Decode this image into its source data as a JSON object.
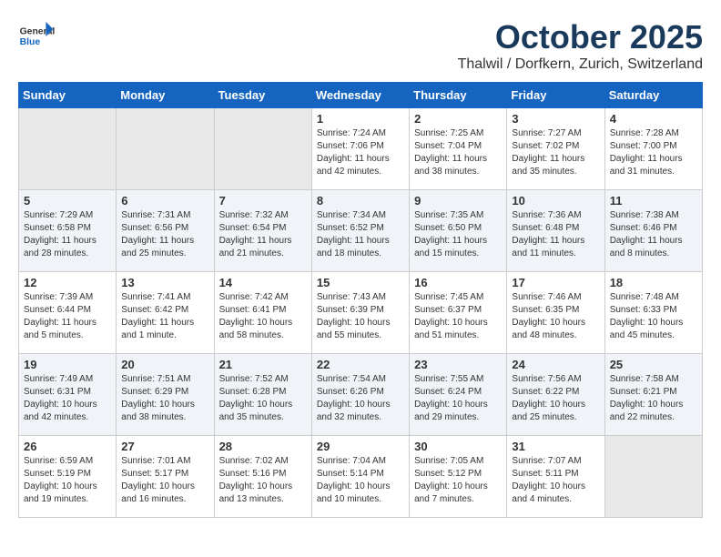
{
  "header": {
    "logo_general": "General",
    "logo_blue": "Blue",
    "month": "October 2025",
    "location": "Thalwil / Dorfkern, Zurich, Switzerland"
  },
  "weekdays": [
    "Sunday",
    "Monday",
    "Tuesday",
    "Wednesday",
    "Thursday",
    "Friday",
    "Saturday"
  ],
  "weeks": [
    [
      {
        "day": "",
        "empty": true
      },
      {
        "day": "",
        "empty": true
      },
      {
        "day": "",
        "empty": true
      },
      {
        "day": "1",
        "sunrise": "7:24 AM",
        "sunset": "7:06 PM",
        "daylight": "11 hours and 42 minutes."
      },
      {
        "day": "2",
        "sunrise": "7:25 AM",
        "sunset": "7:04 PM",
        "daylight": "11 hours and 38 minutes."
      },
      {
        "day": "3",
        "sunrise": "7:27 AM",
        "sunset": "7:02 PM",
        "daylight": "11 hours and 35 minutes."
      },
      {
        "day": "4",
        "sunrise": "7:28 AM",
        "sunset": "7:00 PM",
        "daylight": "11 hours and 31 minutes."
      }
    ],
    [
      {
        "day": "5",
        "sunrise": "7:29 AM",
        "sunset": "6:58 PM",
        "daylight": "11 hours and 28 minutes."
      },
      {
        "day": "6",
        "sunrise": "7:31 AM",
        "sunset": "6:56 PM",
        "daylight": "11 hours and 25 minutes."
      },
      {
        "day": "7",
        "sunrise": "7:32 AM",
        "sunset": "6:54 PM",
        "daylight": "11 hours and 21 minutes."
      },
      {
        "day": "8",
        "sunrise": "7:34 AM",
        "sunset": "6:52 PM",
        "daylight": "11 hours and 18 minutes."
      },
      {
        "day": "9",
        "sunrise": "7:35 AM",
        "sunset": "6:50 PM",
        "daylight": "11 hours and 15 minutes."
      },
      {
        "day": "10",
        "sunrise": "7:36 AM",
        "sunset": "6:48 PM",
        "daylight": "11 hours and 11 minutes."
      },
      {
        "day": "11",
        "sunrise": "7:38 AM",
        "sunset": "6:46 PM",
        "daylight": "11 hours and 8 minutes."
      }
    ],
    [
      {
        "day": "12",
        "sunrise": "7:39 AM",
        "sunset": "6:44 PM",
        "daylight": "11 hours and 5 minutes."
      },
      {
        "day": "13",
        "sunrise": "7:41 AM",
        "sunset": "6:42 PM",
        "daylight": "11 hours and 1 minute."
      },
      {
        "day": "14",
        "sunrise": "7:42 AM",
        "sunset": "6:41 PM",
        "daylight": "10 hours and 58 minutes."
      },
      {
        "day": "15",
        "sunrise": "7:43 AM",
        "sunset": "6:39 PM",
        "daylight": "10 hours and 55 minutes."
      },
      {
        "day": "16",
        "sunrise": "7:45 AM",
        "sunset": "6:37 PM",
        "daylight": "10 hours and 51 minutes."
      },
      {
        "day": "17",
        "sunrise": "7:46 AM",
        "sunset": "6:35 PM",
        "daylight": "10 hours and 48 minutes."
      },
      {
        "day": "18",
        "sunrise": "7:48 AM",
        "sunset": "6:33 PM",
        "daylight": "10 hours and 45 minutes."
      }
    ],
    [
      {
        "day": "19",
        "sunrise": "7:49 AM",
        "sunset": "6:31 PM",
        "daylight": "10 hours and 42 minutes."
      },
      {
        "day": "20",
        "sunrise": "7:51 AM",
        "sunset": "6:29 PM",
        "daylight": "10 hours and 38 minutes."
      },
      {
        "day": "21",
        "sunrise": "7:52 AM",
        "sunset": "6:28 PM",
        "daylight": "10 hours and 35 minutes."
      },
      {
        "day": "22",
        "sunrise": "7:54 AM",
        "sunset": "6:26 PM",
        "daylight": "10 hours and 32 minutes."
      },
      {
        "day": "23",
        "sunrise": "7:55 AM",
        "sunset": "6:24 PM",
        "daylight": "10 hours and 29 minutes."
      },
      {
        "day": "24",
        "sunrise": "7:56 AM",
        "sunset": "6:22 PM",
        "daylight": "10 hours and 25 minutes."
      },
      {
        "day": "25",
        "sunrise": "7:58 AM",
        "sunset": "6:21 PM",
        "daylight": "10 hours and 22 minutes."
      }
    ],
    [
      {
        "day": "26",
        "sunrise": "6:59 AM",
        "sunset": "5:19 PM",
        "daylight": "10 hours and 19 minutes."
      },
      {
        "day": "27",
        "sunrise": "7:01 AM",
        "sunset": "5:17 PM",
        "daylight": "10 hours and 16 minutes."
      },
      {
        "day": "28",
        "sunrise": "7:02 AM",
        "sunset": "5:16 PM",
        "daylight": "10 hours and 13 minutes."
      },
      {
        "day": "29",
        "sunrise": "7:04 AM",
        "sunset": "5:14 PM",
        "daylight": "10 hours and 10 minutes."
      },
      {
        "day": "30",
        "sunrise": "7:05 AM",
        "sunset": "5:12 PM",
        "daylight": "10 hours and 7 minutes."
      },
      {
        "day": "31",
        "sunrise": "7:07 AM",
        "sunset": "5:11 PM",
        "daylight": "10 hours and 4 minutes."
      },
      {
        "day": "",
        "empty": true
      }
    ]
  ]
}
